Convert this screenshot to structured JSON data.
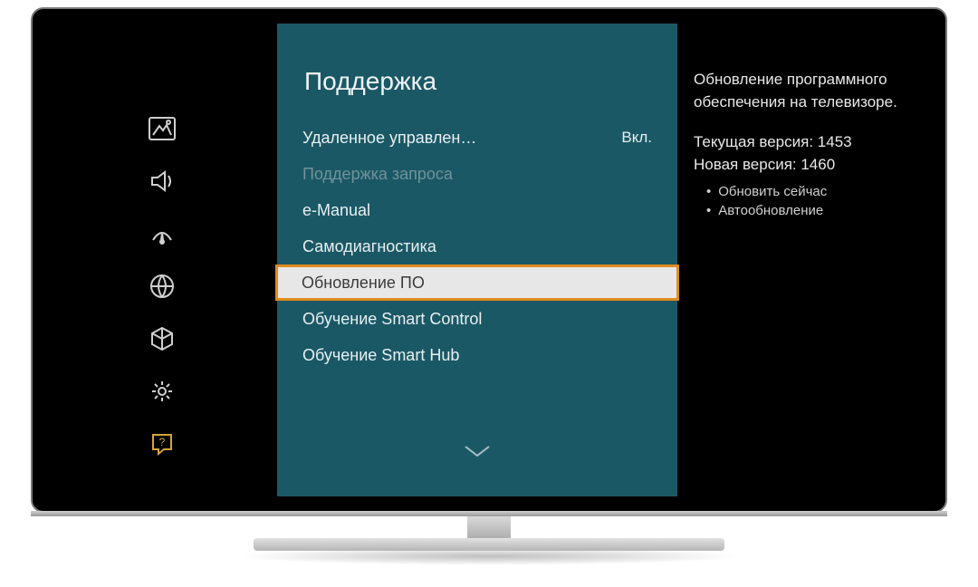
{
  "sidebar": {
    "icons": [
      {
        "name": "picture-icon"
      },
      {
        "name": "sound-icon"
      },
      {
        "name": "broadcast-icon"
      },
      {
        "name": "network-icon"
      },
      {
        "name": "system-icon"
      },
      {
        "name": "settings-icon"
      },
      {
        "name": "support-icon"
      }
    ],
    "active_index": 6
  },
  "menu": {
    "title": "Поддержка",
    "items": [
      {
        "label": "Удаленное управлен…",
        "value": "Вкл.",
        "disabled": false,
        "selected": false
      },
      {
        "label": "Поддержка запроса",
        "value": "",
        "disabled": true,
        "selected": false
      },
      {
        "label": "e-Manual",
        "value": "",
        "disabled": false,
        "selected": false
      },
      {
        "label": "Самодиагностика",
        "value": "",
        "disabled": false,
        "selected": false
      },
      {
        "label": "Обновление ПО",
        "value": "",
        "disabled": false,
        "selected": true
      },
      {
        "label": "Обучение Smart Control",
        "value": "",
        "disabled": false,
        "selected": false
      },
      {
        "label": "Обучение Smart Hub",
        "value": "",
        "disabled": false,
        "selected": false
      }
    ]
  },
  "info": {
    "description": "Обновление программного обеспечения на телевизоре.",
    "current_version_label": "Текущая версия: 1453",
    "new_version_label": "Новая версия: 1460",
    "bullets": [
      "Обновить сейчас",
      "Автообновление"
    ]
  }
}
